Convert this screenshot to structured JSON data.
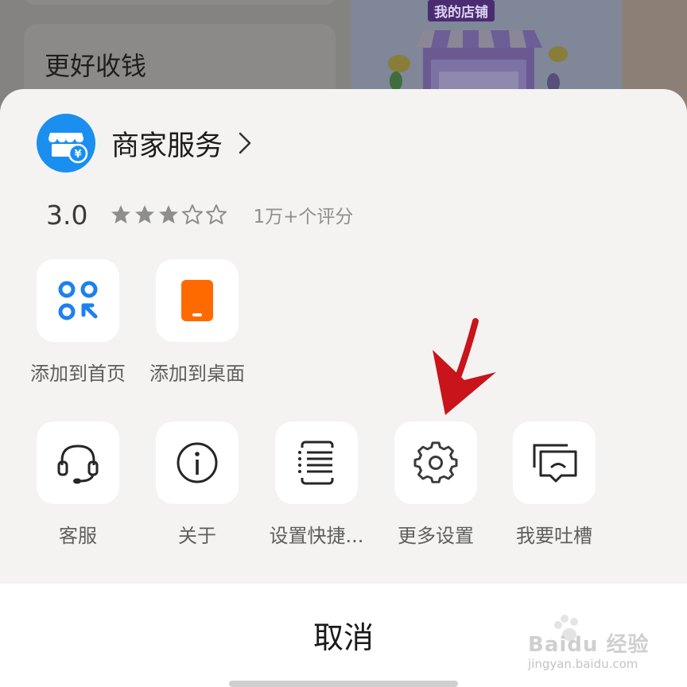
{
  "background": {
    "card_title": "更好收钱",
    "banner_label": "我的店铺"
  },
  "app": {
    "name": "商家服务",
    "logo_icon": "store-yuan-icon",
    "rating_score": "3.0",
    "rating_stars": 3,
    "rating_max": 5,
    "rating_count": "1万+个评分"
  },
  "actions_row1": [
    {
      "label": "添加到首页",
      "icon": "add-to-home-icon"
    },
    {
      "label": "添加到桌面",
      "icon": "phone-icon"
    }
  ],
  "actions_row2": [
    {
      "label": "客服",
      "icon": "headset-icon"
    },
    {
      "label": "关于",
      "icon": "info-icon"
    },
    {
      "label": "设置快捷...",
      "icon": "shortcut-list-icon"
    },
    {
      "label": "更多设置",
      "icon": "gear-icon"
    },
    {
      "label": "我要吐槽",
      "icon": "feedback-icon"
    }
  ],
  "cancel_label": "取消",
  "watermark": {
    "brand": "Baidu 经验",
    "url": "jingyan.baidu.com"
  },
  "colors": {
    "brand_blue": "#1a8ff0",
    "accent_orange": "#ff6a00",
    "action_blue": "#1e7ff0",
    "annotation_red": "#c8141a"
  }
}
